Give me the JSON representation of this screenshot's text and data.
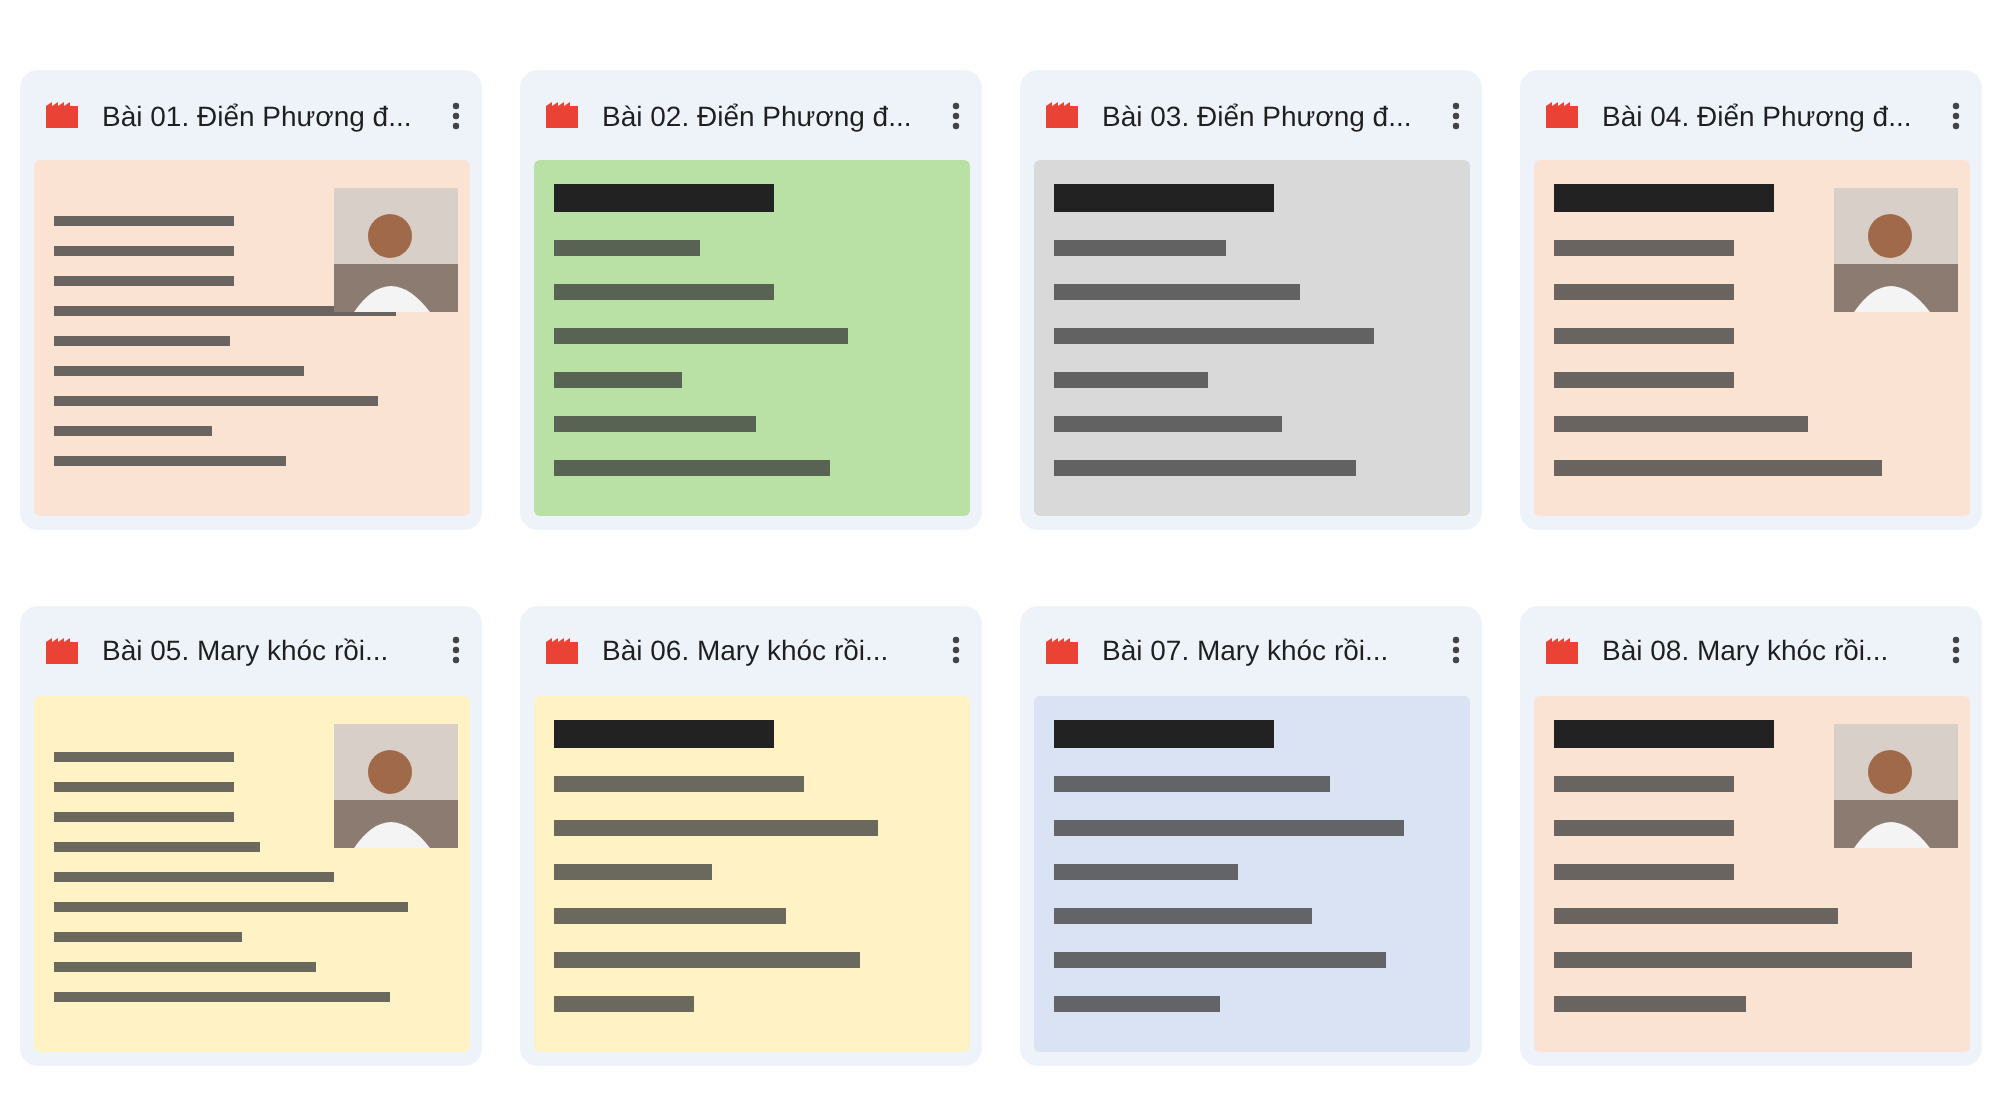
{
  "files": [
    {
      "title": "Bài 01. Điển Phương đ..."
    },
    {
      "title": "Bài 02. Điển Phương đ..."
    },
    {
      "title": "Bài 03. Điển Phương đ..."
    },
    {
      "title": "Bài 04. Điển Phương đ..."
    },
    {
      "title": "Bài 05. Mary khóc rồi..."
    },
    {
      "title": "Bài 06. Mary khóc rồi..."
    },
    {
      "title": "Bài 07. Mary khóc rồi..."
    },
    {
      "title": "Bài 08. Mary khóc rồi..."
    }
  ]
}
